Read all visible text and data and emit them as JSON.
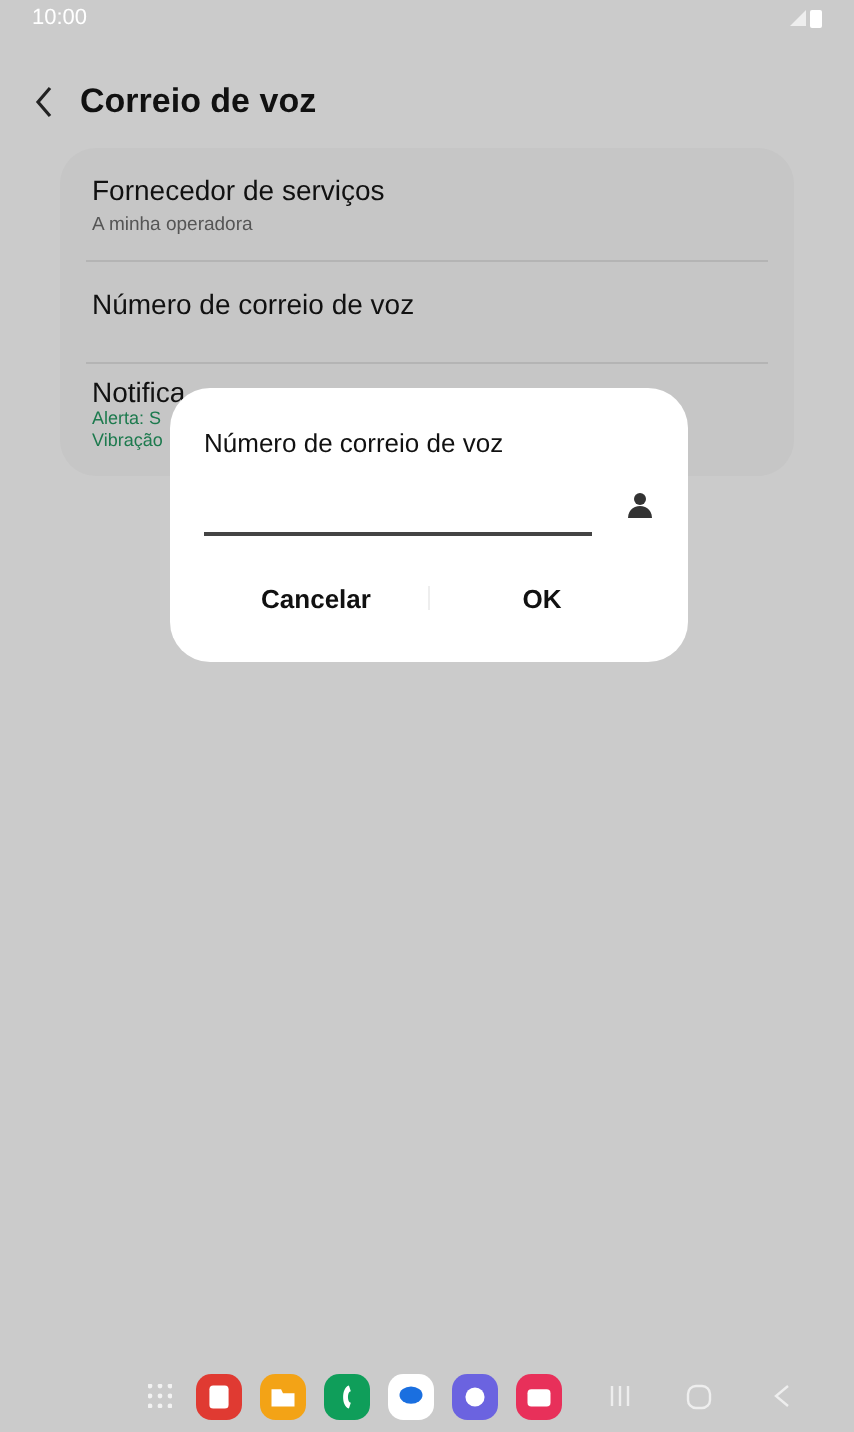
{
  "status_bar": {
    "time": "10:00"
  },
  "header": {
    "title": "Correio de voz"
  },
  "settings": [
    {
      "title": "Fornecedor de serviços",
      "subtitle": "A minha operadora"
    },
    {
      "title": "Número de correio de voz"
    },
    {
      "title": "Notifica",
      "details": [
        "Alerta: S",
        "Vibração"
      ]
    }
  ],
  "dialog": {
    "title": "Número de correio de voz",
    "buttons": [
      "Cancelar",
      "OK"
    ]
  },
  "dock": [
    {
      "color": "#e03a32"
    },
    {
      "color": "#f3a316"
    },
    {
      "color": "#0f9e5a"
    },
    {
      "color": "#ffffff"
    },
    {
      "color": "#6b63e0"
    },
    {
      "color": "#e8305a"
    }
  ]
}
